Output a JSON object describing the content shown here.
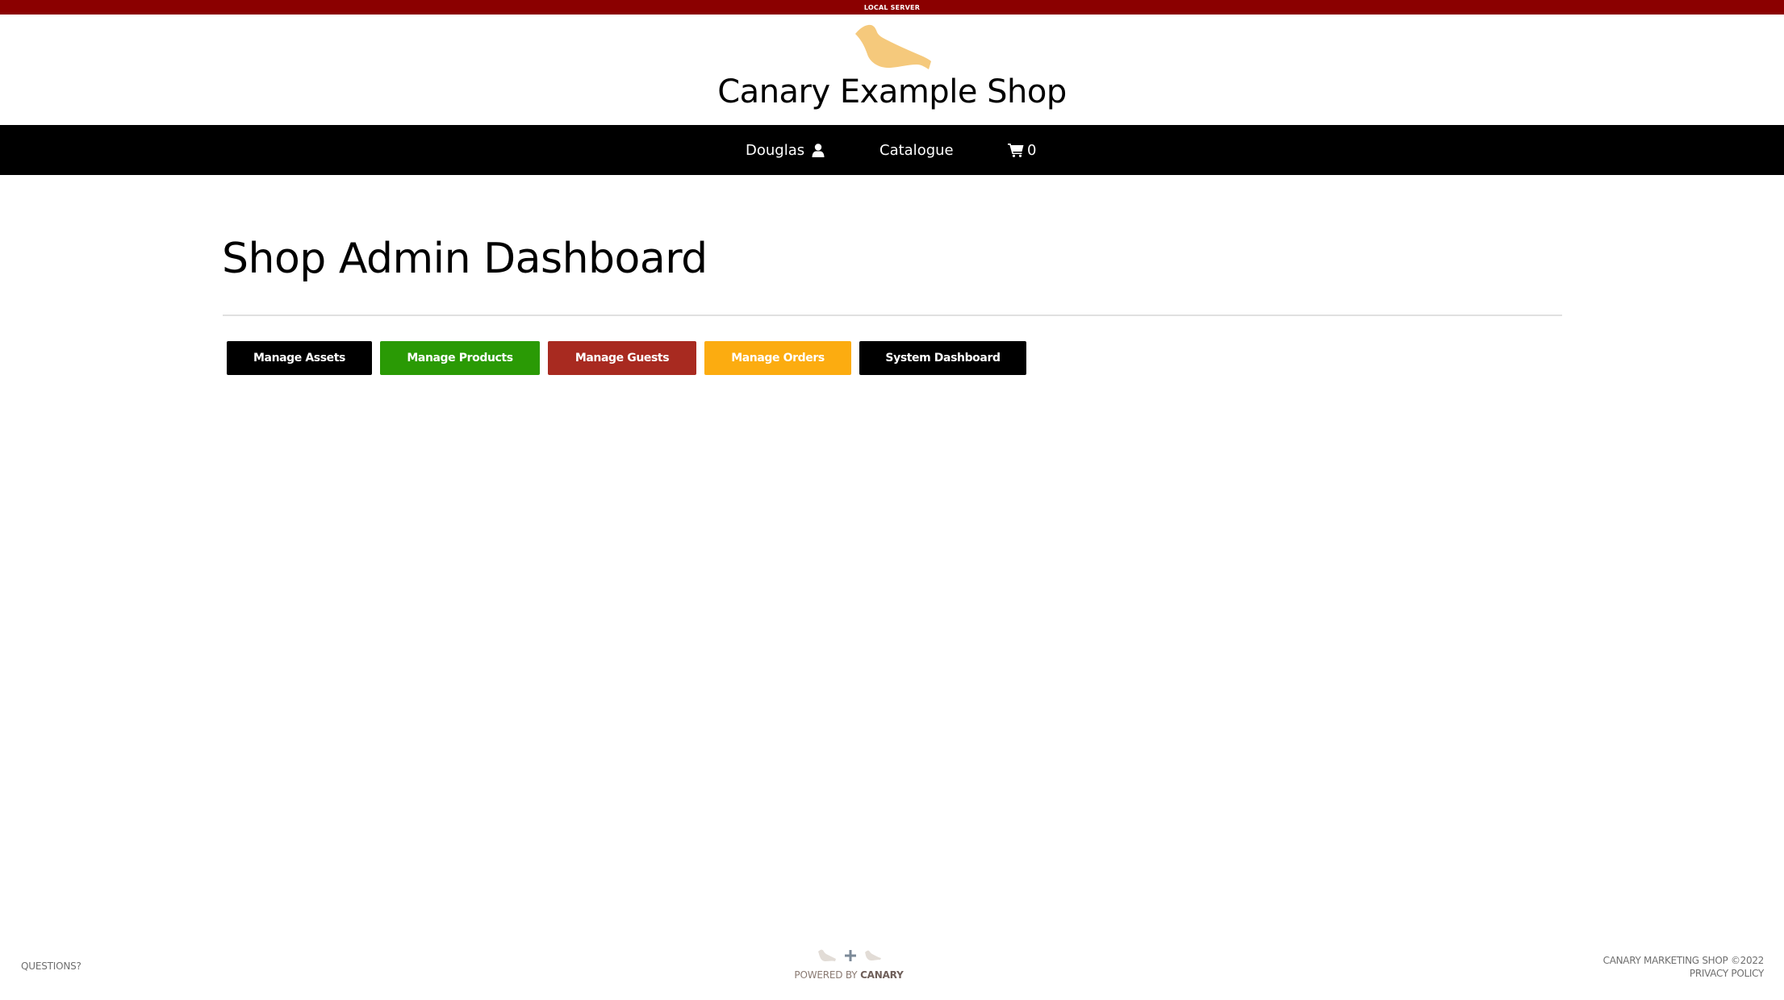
{
  "environment_banner": "LOCAL SERVER",
  "header": {
    "logo_icon": "canary-bird-icon",
    "title": "Canary Example Shop"
  },
  "nav": {
    "user": {
      "label": "Douglas",
      "icon": "user-icon"
    },
    "catalogue": {
      "label": "Catalogue"
    },
    "cart": {
      "icon": "shopping-cart-icon",
      "count": "0"
    }
  },
  "main": {
    "title": "Shop Admin Dashboard",
    "buttons": [
      {
        "label": "Manage Assets",
        "color": "#000000"
      },
      {
        "label": "Manage Products",
        "color": "#2a9a05"
      },
      {
        "label": "Manage Guests",
        "color": "#a82a20"
      },
      {
        "label": "Manage Orders",
        "color": "#fcac10"
      },
      {
        "label": "System Dashboard",
        "color": "#000000"
      }
    ]
  },
  "footer": {
    "questions": "QUESTIONS?",
    "powered_by_prefix": "POWERED BY",
    "powered_by_brand": "CANARY",
    "copyright": "CANARY MARKETING SHOP ©2022",
    "privacy": "PRIVACY POLICY"
  },
  "colors": {
    "env_banner": "#8b0000",
    "nav_background": "#000000",
    "logo": "#f5c97c"
  }
}
